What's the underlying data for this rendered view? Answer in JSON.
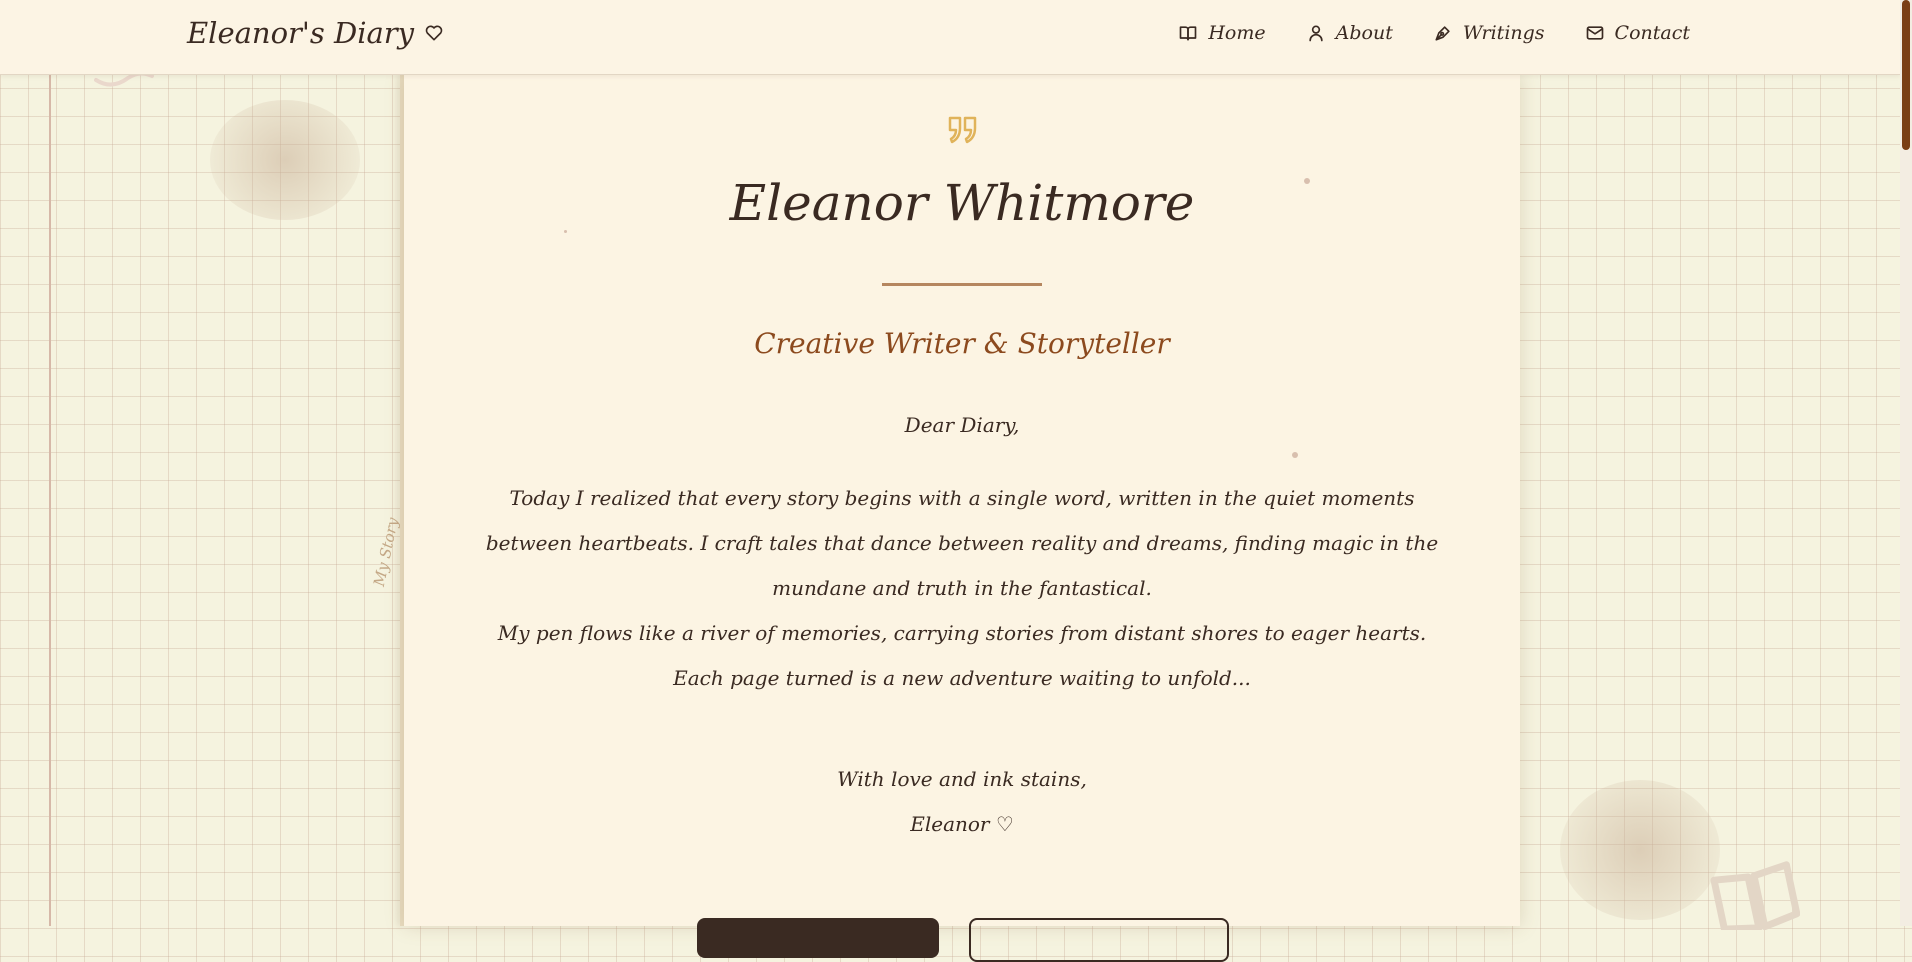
{
  "header": {
    "brand": "Eleanor's Diary",
    "nav": [
      {
        "label": "Home",
        "icon": "book-icon"
      },
      {
        "label": "About",
        "icon": "user-icon"
      },
      {
        "label": "Writings",
        "icon": "pen-icon"
      },
      {
        "label": "Contact",
        "icon": "mail-icon"
      }
    ]
  },
  "sidebar": {
    "label": "My Story"
  },
  "main": {
    "name": "Eleanor Whitmore",
    "role": "Creative Writer & Storyteller",
    "greeting": "Dear Diary,",
    "paragraphs": [
      "Today I realized that every story begins with a single word, written in the quiet moments between heartbeats. I craft tales that dance between reality and dreams, finding magic in the mundane and truth in the fantastical.",
      "My pen flows like a river of memories, carrying stories from distant shores to eager hearts. Each page turned is a new adventure waiting to unfold..."
    ],
    "closing": "With love and ink stains,",
    "signature": "Eleanor ♡"
  },
  "colors": {
    "ink": "#3a2a22",
    "accent": "#8c4a1e",
    "paper": "#fcf4e3",
    "gold": "#e0b35a",
    "scroll_thumb": "#7a3e15"
  }
}
